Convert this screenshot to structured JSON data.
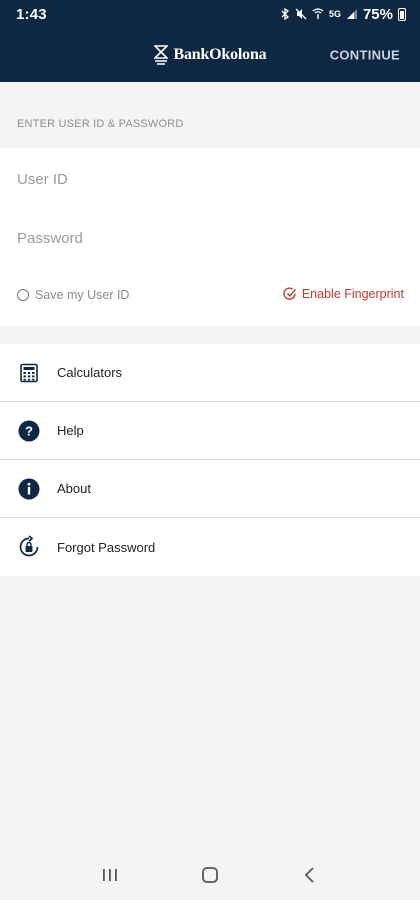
{
  "status_bar": {
    "time": "1:43",
    "network": "5G",
    "battery": "75%"
  },
  "header": {
    "brand": "BankOkolona",
    "continue_label": "CONTINUE"
  },
  "login": {
    "section_label": "ENTER USER ID & PASSWORD",
    "userid_placeholder": "User ID",
    "password_placeholder": "Password",
    "save_label": "Save my User ID",
    "fingerprint_label": "Enable Fingerprint"
  },
  "menu": {
    "items": [
      {
        "label": "Calculators",
        "icon": "calculator-icon"
      },
      {
        "label": "Help",
        "icon": "help-icon"
      },
      {
        "label": "About",
        "icon": "info-icon"
      },
      {
        "label": "Forgot Password",
        "icon": "lock-reset-icon"
      }
    ]
  },
  "colors": {
    "header_bg": "#0e2742",
    "accent_red": "#c0392b",
    "icon_navy": "#0e2742"
  }
}
